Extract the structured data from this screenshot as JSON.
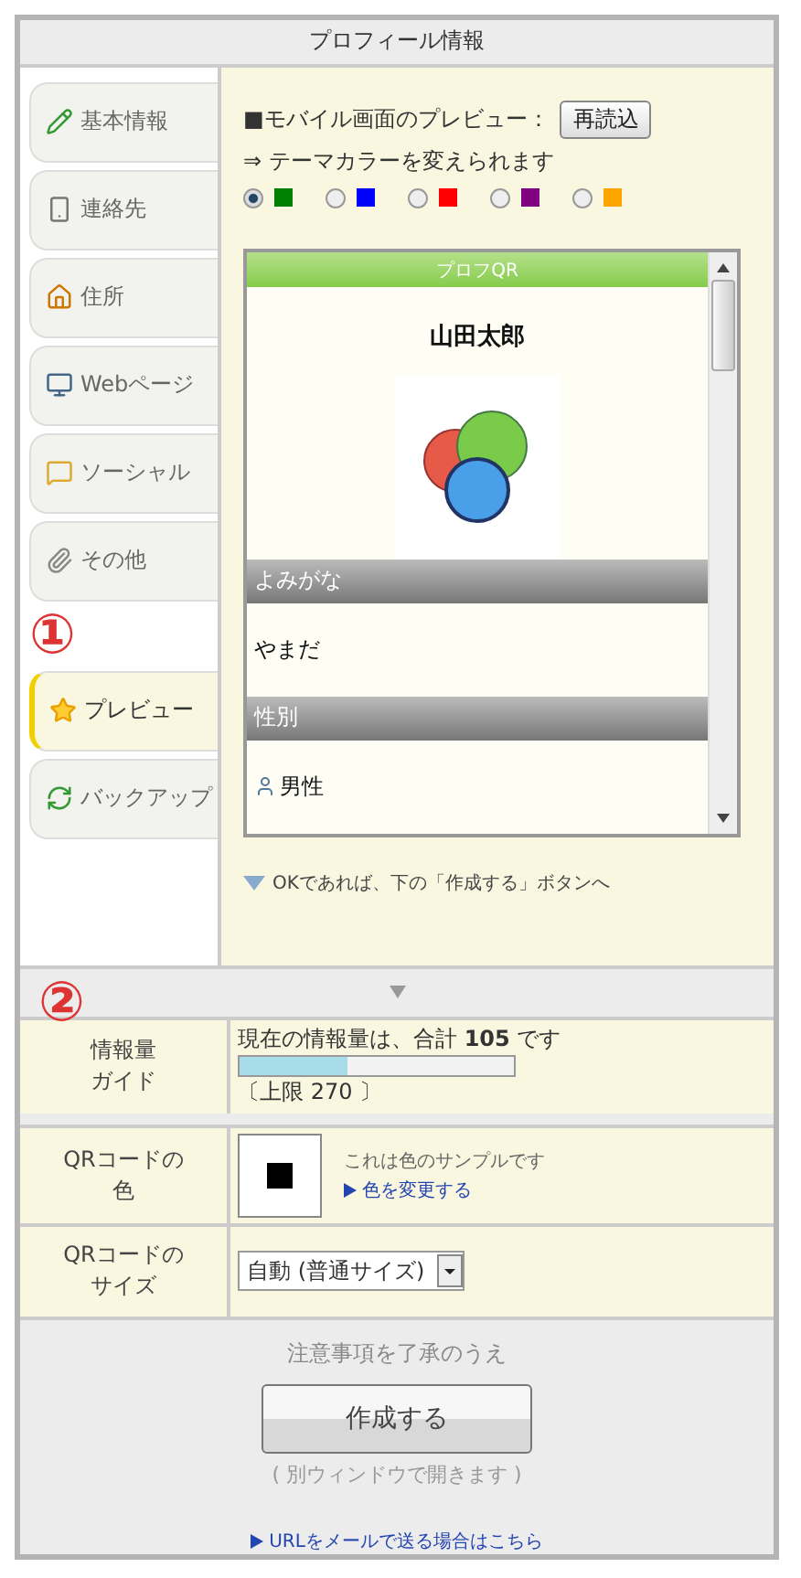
{
  "window": {
    "title": "プロフィール情報"
  },
  "tabs": [
    {
      "label": "基本情報",
      "selected": false
    },
    {
      "label": "連絡先",
      "selected": false
    },
    {
      "label": "住所",
      "selected": false
    },
    {
      "label": "Webページ",
      "selected": false
    },
    {
      "label": "ソーシャル",
      "selected": false
    },
    {
      "label": "その他",
      "selected": false
    },
    {
      "label": "プレビュー",
      "selected": true,
      "annotation": "①"
    },
    {
      "label": "バックアップ",
      "selected": false
    }
  ],
  "preview": {
    "heading": "■モバイル画面のプレビュー：",
    "reload_button": "再読込",
    "hint": "⇒ テーマカラーを変えられます",
    "theme_colors": [
      {
        "color": "#007f00",
        "selected": true
      },
      {
        "color": "#0000ff",
        "selected": false
      },
      {
        "color": "#ff0000",
        "selected": false
      },
      {
        "color": "#800080",
        "selected": false
      },
      {
        "color": "#ffa500",
        "selected": false
      }
    ],
    "mobile": {
      "title": "プロフQR",
      "name": "山田太郎",
      "sections": [
        {
          "label": "よみがな",
          "value": "やまだ"
        },
        {
          "label": "性別",
          "value": "男性"
        }
      ]
    },
    "footer_note": "OKであれば、下の「作成する」ボタンへ"
  },
  "divider_annotation": "②",
  "info_guide": {
    "label": [
      "情報量",
      "ガイド"
    ],
    "text": "現在の情報量は、合計 **105** です",
    "level": 0.39,
    "limit": "〔上限 270 〕"
  },
  "qr_color": {
    "label": [
      "QRコードの",
      "色"
    ],
    "color": "#000000",
    "sample_text": "これは色のサンプルです",
    "change_link": "色を変更する"
  },
  "qr_size": {
    "label": [
      "QRコードの",
      "サイズ"
    ],
    "value": "自動 (普通サイズ)"
  },
  "submit": {
    "notice": "注意事項を了承のうえ",
    "button": "作成する",
    "note": "( 別ウィンドウで開きます )",
    "mail_link": "URLをメールで送る場合はこちら"
  }
}
